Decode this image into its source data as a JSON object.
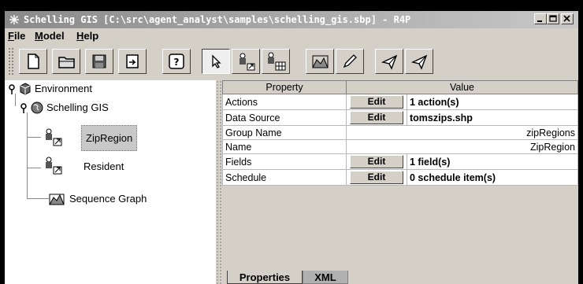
{
  "window": {
    "title": "Schelling GIS [C:\\src\\agent_analyst\\samples\\schelling_gis.sbp] - R4P",
    "controls": [
      "minimize",
      "maximize",
      "close"
    ]
  },
  "menu": [
    {
      "label": "File"
    },
    {
      "label": "Model"
    },
    {
      "label": "Help"
    }
  ],
  "toolbar": {
    "buttons": [
      {
        "name": "new-icon"
      },
      {
        "name": "open-folder-icon"
      },
      {
        "name": "save-icon"
      },
      {
        "name": "export-icon"
      },
      {
        "name": "help-icon"
      },
      {
        "name": "pointer-icon",
        "active": true
      },
      {
        "name": "agent-link-icon"
      },
      {
        "name": "agent-grid-icon"
      },
      {
        "name": "chart-icon"
      },
      {
        "name": "pencil-icon"
      },
      {
        "name": "send-icon"
      },
      {
        "name": "send-alt-icon"
      }
    ]
  },
  "tree": {
    "root": "Environment",
    "model": "Schelling GIS",
    "items": [
      {
        "label": "ZipRegion",
        "selected": true
      },
      {
        "label": "Resident",
        "selected": false
      },
      {
        "label": "Sequence Graph",
        "selected": false
      }
    ]
  },
  "properties": {
    "headers": [
      "Property",
      "Value"
    ],
    "edit_label": "Edit",
    "rows": [
      {
        "name": "Actions",
        "editable": true,
        "value": "1 action(s)"
      },
      {
        "name": "Data Source",
        "editable": true,
        "value": "tomszips.shp"
      },
      {
        "name": "Group Name",
        "editable": false,
        "value": "zipRegions"
      },
      {
        "name": "Name",
        "editable": false,
        "value": "ZipRegion"
      },
      {
        "name": "Fields",
        "editable": true,
        "value": "1 field(s)"
      },
      {
        "name": "Schedule",
        "editable": true,
        "value": "0 schedule item(s)"
      }
    ]
  },
  "tabs": [
    {
      "label": "Properties",
      "active": true
    },
    {
      "label": "XML",
      "active": false
    }
  ]
}
